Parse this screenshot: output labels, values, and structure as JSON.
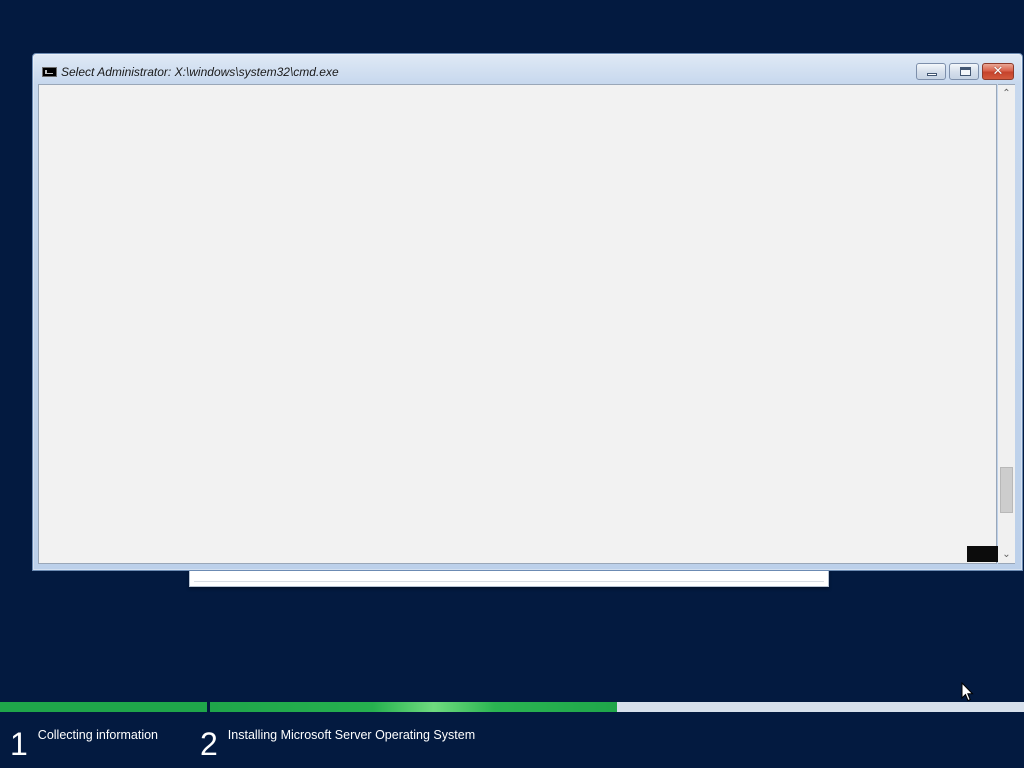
{
  "cmd_window": {
    "title": "Select Administrator: X:\\windows\\system32\\cmd.exe",
    "buttons": {
      "minimize_glyph": "minimize-icon",
      "maximize_glyph": "maximize-icon",
      "close_glyph": "✕"
    },
    "scrollbar": {
      "up_arrow": "⌃",
      "down_arrow": "⌄"
    },
    "content_lines": []
  },
  "setup_progress": {
    "steps": [
      {
        "number": "1",
        "label": "Collecting information",
        "progress": 1.0
      },
      {
        "number": "2",
        "label": "Installing Microsoft Server Operating System",
        "progress": 0.5
      }
    ]
  },
  "colors": {
    "desktop_background": "#031a40",
    "progress_fill": "#1fa64a",
    "progress_track": "#d7e0ec",
    "console_background": "#f2f2f2",
    "close_button": "#c5432c"
  },
  "icons": {
    "app_icon": "cmd-icon",
    "pointer": "mouse-pointer-icon"
  }
}
